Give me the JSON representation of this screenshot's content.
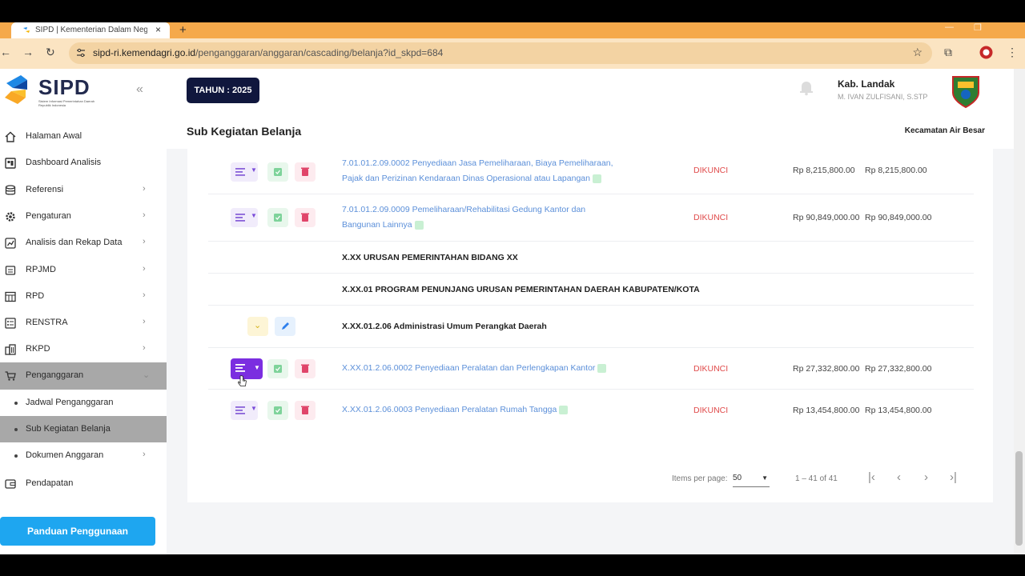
{
  "browser": {
    "tab_title": "SIPD | Kementerian Dalam Negeri",
    "tab_close": "×",
    "new_tab": "+",
    "url_host": "sipd-ri.kemendagri.go.id",
    "url_path": "/penganggaran/anggaran/cascading/belanja?id_skpd=684",
    "back_icon": "←",
    "forward_icon": "→",
    "reload_icon": "↻",
    "star_icon": "☆",
    "extensions_icon": "⧉",
    "menu_icon": "⋮",
    "minimize_icon": "—",
    "restore_icon": "❐"
  },
  "sidebar": {
    "brand": "SIPD",
    "brand_sub": "Sistem Informasi Pemerintahan Daerah Republik Indonesia",
    "collapse_icon": "«",
    "items": [
      {
        "label": "Halaman Awal",
        "icon": "home-icon",
        "chev": ""
      },
      {
        "label": "Dashboard Analisis",
        "icon": "dashboard-icon",
        "chev": ""
      },
      {
        "label": "Referensi",
        "icon": "database-icon",
        "chev": "›"
      },
      {
        "label": "Pengaturan",
        "icon": "gear-icon",
        "chev": "›"
      },
      {
        "label": "Analisis dan Rekap Data",
        "icon": "chart-icon",
        "chev": "›"
      },
      {
        "label": "RPJMD",
        "icon": "document-icon",
        "chev": "›"
      },
      {
        "label": "RPD",
        "icon": "table-icon",
        "chev": "›"
      },
      {
        "label": "RENSTRA",
        "icon": "list-icon",
        "chev": "›"
      },
      {
        "label": "RKPD",
        "icon": "building-icon",
        "chev": "›"
      },
      {
        "label": "Penganggaran",
        "icon": "cart-icon",
        "chev": "⌄"
      }
    ],
    "sub_items": [
      {
        "label": "Jadwal Penganggaran",
        "chev": ""
      },
      {
        "label": "Sub Kegiatan Belanja",
        "chev": ""
      },
      {
        "label": "Dokumen Anggaran",
        "chev": "›"
      }
    ],
    "pendapatan": "Pendapatan",
    "guide_button": "Panduan Penggunaan"
  },
  "header": {
    "year_badge": "TAHUN : 2025",
    "user_region": "Kab. Landak",
    "user_name": "M. IVAN ZULFISANI, S.STP",
    "page_title": "Sub Kegiatan Belanja",
    "unit_name": "Kecamatan Air Besar"
  },
  "table": {
    "rows": [
      {
        "code_title": "7.01.01.2.09.0002 Penyediaan Jasa Pemeliharaan, Biaya Pemeliharaan,",
        "code_title2": "Pajak dan Perizinan Kendaraan Dinas Operasional atau Lapangan",
        "status": "DIKUNCI",
        "amount1": "Rp 8,215,800.00",
        "amount2": "Rp 8,215,800.00"
      },
      {
        "code_title": "7.01.01.2.09.0009 Pemeliharaan/Rehabilitasi Gedung Kantor dan",
        "code_title2": "Bangunan Lainnya",
        "status": "DIKUNCI",
        "amount1": "Rp 90,849,000.00",
        "amount2": "Rp 90,849,000.00"
      },
      {
        "heading": "X.XX URUSAN PEMERINTAHAN BIDANG XX"
      },
      {
        "heading": "X.XX.01 PROGRAM PENUNJANG URUSAN PEMERINTAHAN DAERAH KABUPATEN/KOTA"
      },
      {
        "heading": "X.XX.01.2.06 Administrasi Umum Perangkat Daerah"
      },
      {
        "code_title": "X.XX.01.2.06.0002 Penyediaan Peralatan dan Perlengkapan Kantor",
        "status": "DIKUNCI",
        "amount1": "Rp 27,332,800.00",
        "amount2": "Rp 27,332,800.00"
      },
      {
        "code_title": "X.XX.01.2.06.0003 Penyediaan Peralatan Rumah Tangga",
        "status": "DIKUNCI",
        "amount1": "Rp 13,454,800.00",
        "amount2": "Rp 13,454,800.00"
      }
    ]
  },
  "pagination": {
    "items_per_page_label": "Items per page:",
    "items_per_page_value": "50",
    "range": "1 – 41 of 41",
    "first": "|‹",
    "prev": "‹",
    "next": "›",
    "last": "›|"
  },
  "colors": {
    "accent": "#7b2ee0",
    "brand_navy": "#10173d",
    "link": "#5b8fd9",
    "locked": "#e04a4a",
    "guide_button": "#1ea6f0"
  }
}
